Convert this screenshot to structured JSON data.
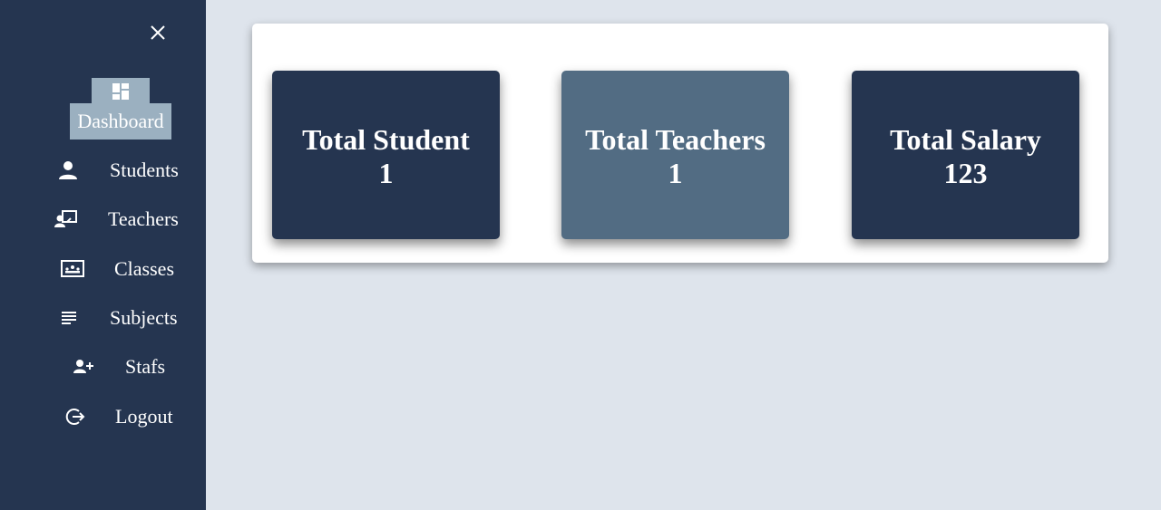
{
  "sidebar": {
    "close_icon": "close-icon",
    "dashboard": {
      "label": "Dashboard",
      "icon": "dashboard-grid-icon"
    },
    "items": [
      {
        "label": "Students",
        "icon": "person-icon"
      },
      {
        "label": "Teachers",
        "icon": "teacher-board-icon"
      },
      {
        "label": "Classes",
        "icon": "class-board-icon"
      },
      {
        "label": "Subjects",
        "icon": "lines-list-icon"
      },
      {
        "label": "Stafs",
        "icon": "person-add-icon"
      },
      {
        "label": "Logout",
        "icon": "logout-icon"
      }
    ]
  },
  "stats": [
    {
      "title": "Total Student",
      "value": "1",
      "color": "#253550"
    },
    {
      "title": "Total Teachers",
      "value": "1",
      "color": "#526c83"
    },
    {
      "title": "Total Salary",
      "value": "123",
      "color": "#253550"
    }
  ],
  "colors": {
    "sidebar_bg": "#253550",
    "active_bg": "#9bb0c0",
    "page_bg": "#dee4ec",
    "card_dark": "#253550",
    "card_light": "#526c83"
  }
}
